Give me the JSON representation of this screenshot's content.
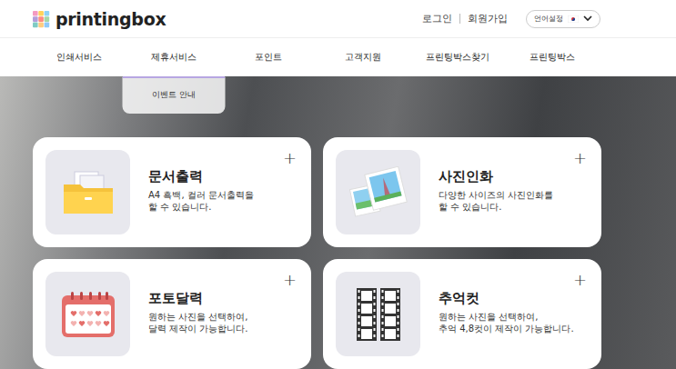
{
  "header": {
    "logo": "printingbox",
    "auth_links": [
      "로그인",
      "회원가입"
    ],
    "language": {
      "label": "언어설정"
    }
  },
  "nav": [
    {
      "label": "인쇄서비스",
      "expanded": false,
      "submenu": []
    },
    {
      "label": "제휴서비스",
      "expanded": true,
      "submenu": [
        "이벤트 안내"
      ]
    },
    {
      "label": "포인트",
      "expanded": false,
      "submenu": []
    },
    {
      "label": "고객지원",
      "expanded": false,
      "submenu": []
    },
    {
      "label": "프린팅박스찾기",
      "expanded": false,
      "submenu": []
    },
    {
      "label": "프린팅박스",
      "expanded": false,
      "submenu": []
    }
  ],
  "cards": [
    {
      "kind": "document",
      "title": "문서출력",
      "description": [
        "A4 흑백, 컬러 문서출력을",
        "할 수 있습니다."
      ],
      "toggle": "+"
    },
    {
      "kind": "photo",
      "title": "사진인화",
      "description": [
        "다양한 사이즈의 사진인화를",
        "할 수 있습니다."
      ],
      "toggle": "+"
    },
    {
      "kind": "calendar",
      "title": "포토달력",
      "description": [
        "원하는 사진을 선택하여,",
        "달력 제작이 가능합니다."
      ],
      "toggle": "+"
    },
    {
      "kind": "film",
      "title": "추억컷",
      "description": [
        "원하는 사진을 선택하여,",
        "추억 4,8컷이 제작이 가능합니다."
      ],
      "toggle": "+"
    }
  ]
}
